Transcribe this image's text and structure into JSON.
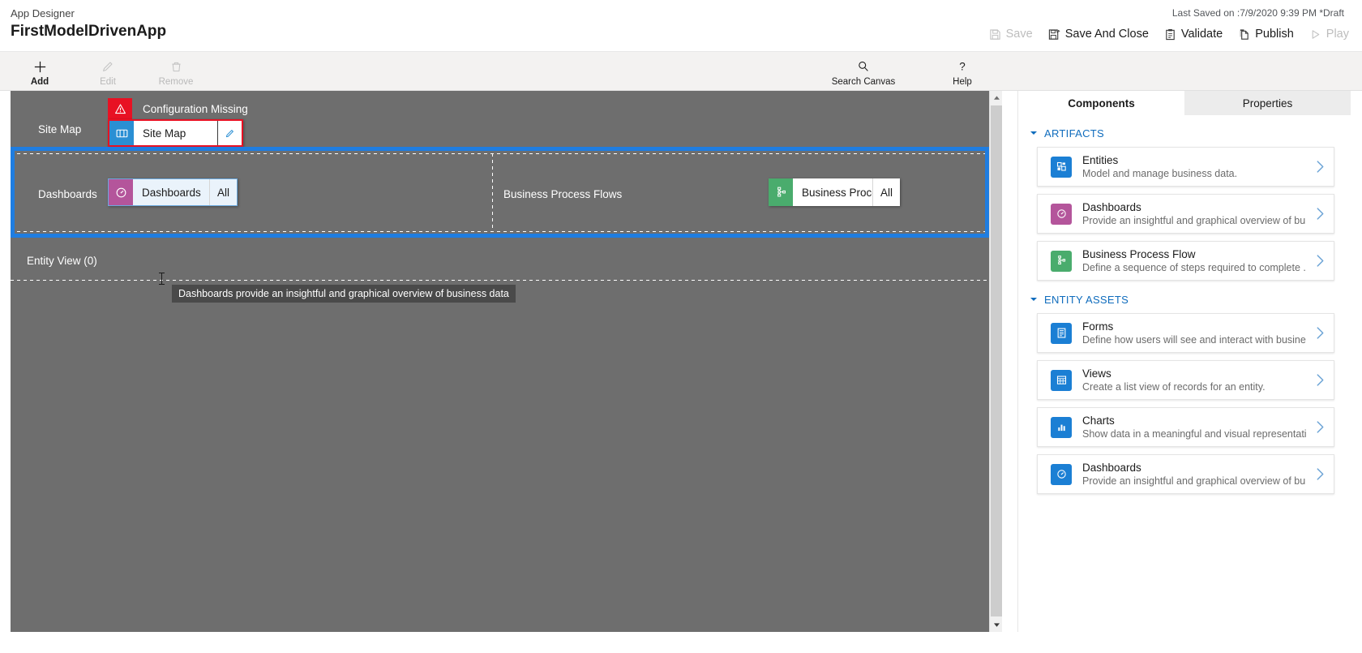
{
  "header": {
    "app_designer_label": "App Designer",
    "app_name": "FirstModelDrivenApp",
    "last_saved": "Last Saved on :7/9/2020 9:39 PM *Draft",
    "actions": [
      {
        "label": "Save",
        "icon": "save-icon",
        "disabled": true
      },
      {
        "label": "Save And Close",
        "icon": "save-and-close-icon",
        "disabled": false
      },
      {
        "label": "Validate",
        "icon": "validate-clipboard-icon",
        "disabled": false
      },
      {
        "label": "Publish",
        "icon": "publish-icon",
        "disabled": false
      },
      {
        "label": "Play",
        "icon": "play-triangle-icon",
        "disabled": true
      }
    ]
  },
  "toolbar": {
    "left": [
      {
        "label": "Add",
        "icon": "plus-icon",
        "disabled": false
      },
      {
        "label": "Edit",
        "icon": "pencil-icon",
        "disabled": true
      },
      {
        "label": "Remove",
        "icon": "trash-icon",
        "disabled": true
      }
    ],
    "right": [
      {
        "label": "Search Canvas",
        "icon": "search-icon",
        "disabled": false
      },
      {
        "label": "Help",
        "icon": "question-mark-icon",
        "disabled": false
      }
    ]
  },
  "canvas": {
    "sitemap_row": {
      "row_label": "Site Map",
      "warning_text": "Configuration Missing",
      "warning_icon": "warning-triangle-icon",
      "tile": {
        "icon": "sitemap-book-icon",
        "name": "Site Map",
        "edit_icon": "pencil-icon"
      }
    },
    "dashboards_row": {
      "row_label": "Dashboards",
      "tile": {
        "icon": "dashboard-gauge-icon",
        "name": "Dashboards",
        "all": "All"
      },
      "tooltip": "Dashboards provide an insightful and graphical overview of business data",
      "bpf_row_label": "Business Process Flows",
      "bpf_tile": {
        "icon": "business-process-flow-icon",
        "name": "Business Proces...",
        "all": "All"
      }
    },
    "entity_view_row": {
      "row_label": "Entity View (0)"
    }
  },
  "panel": {
    "tabs": [
      {
        "label": "Components",
        "active": true
      },
      {
        "label": "Properties",
        "active": false
      }
    ],
    "sections": [
      {
        "title": "ARTIFACTS",
        "expanded": true,
        "cards": [
          {
            "title": "Entities",
            "desc": "Model and manage business data.",
            "icon": "entities-grid-icon",
            "color": "blue"
          },
          {
            "title": "Dashboards",
            "desc": "Provide an insightful and graphical overview of bu...",
            "icon": "dashboard-gauge-icon",
            "color": "purple"
          },
          {
            "title": "Business Process Flow",
            "desc": "Define a sequence of steps required to complete ...",
            "icon": "business-process-flow-icon",
            "color": "green"
          }
        ]
      },
      {
        "title": "ENTITY ASSETS",
        "expanded": true,
        "cards": [
          {
            "title": "Forms",
            "desc": "Define how users will see and interact with busine...",
            "icon": "form-document-icon",
            "color": "blue"
          },
          {
            "title": "Views",
            "desc": "Create a list view of records for an entity.",
            "icon": "views-table-icon",
            "color": "blue"
          },
          {
            "title": "Charts",
            "desc": "Show data in a meaningful and visual representati...",
            "icon": "charts-bar-icon",
            "color": "blue"
          },
          {
            "title": "Dashboards",
            "desc": "Provide an insightful and graphical overview of bu...",
            "icon": "dashboard-gauge-icon",
            "color": "blue"
          }
        ]
      }
    ],
    "chevron_icon": "chevron-right-icon"
  },
  "colors": {
    "accent_blue": "#0f6cbd",
    "selection_blue": "#1f7de0",
    "error_red": "#e81123",
    "canvas_gray": "#6e6e6e",
    "dashboard_purple": "#b4559b",
    "bpf_green": "#4aac6d"
  }
}
